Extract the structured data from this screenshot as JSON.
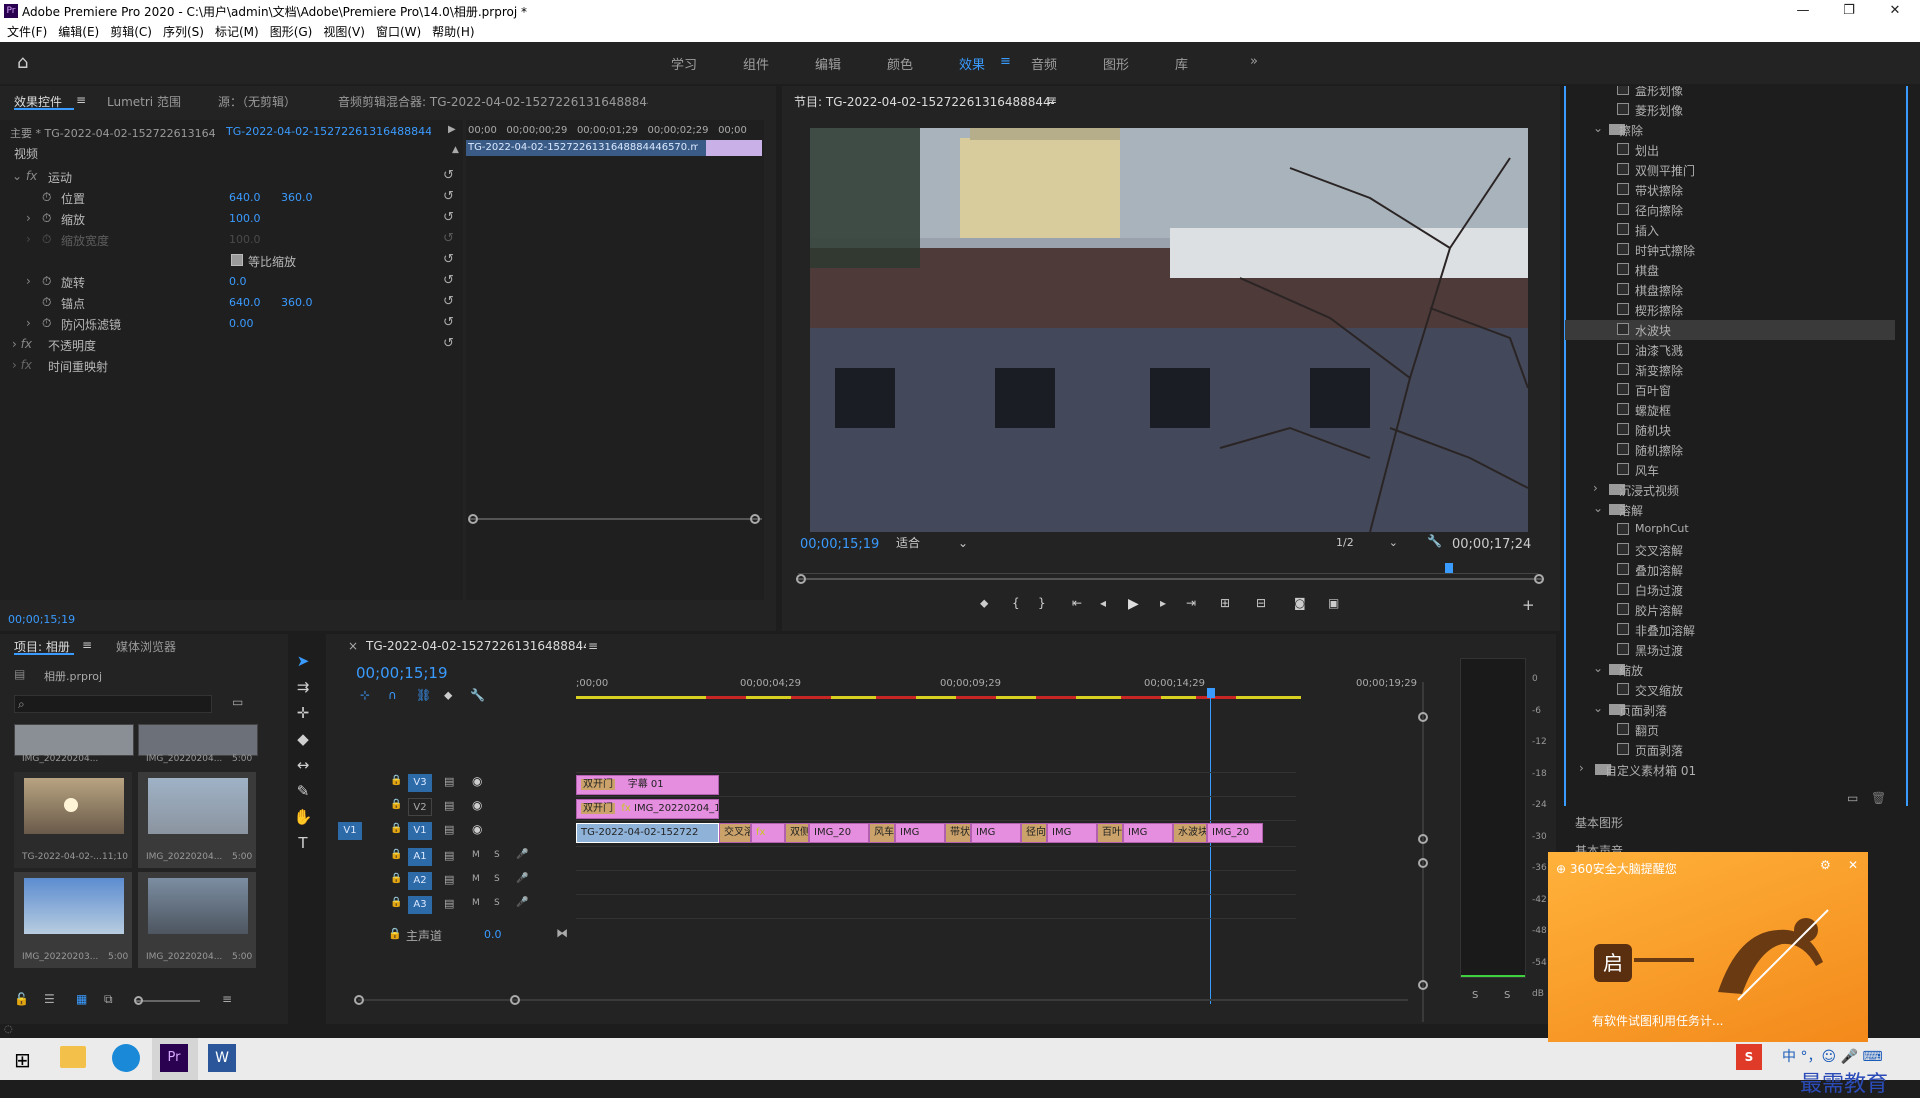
{
  "window": {
    "title": "Adobe Premiere Pro 2020 - C:\\用户\\admin\\文档\\Adobe\\Premiere Pro\\14.0\\相册.prproj *",
    "app_icon": "Pr"
  },
  "menu": [
    "文件(F)",
    "编辑(E)",
    "剪辑(C)",
    "序列(S)",
    "标记(M)",
    "图形(G)",
    "视图(V)",
    "窗口(W)",
    "帮助(H)"
  ],
  "workspaces": {
    "items": [
      "学习",
      "组件",
      "编辑",
      "颜色",
      "效果",
      "音频",
      "图形",
      "库"
    ],
    "active": "效果",
    "more": "»"
  },
  "effect_controls": {
    "tabs": [
      "效果控件",
      "Lumetri 范围",
      "源：（无剪辑）",
      "音频剪辑混合器: TG-2022-04-02-152722613164888444657​0"
    ],
    "master": "主要 * TG-2022-04-02-152722613164...",
    "clip": "TG-2022-04-02-15272261316488844...",
    "ruler": [
      "00;00",
      "00;00;00;29",
      "00;00;01;29",
      "00;00;02;29",
      "00;00"
    ],
    "clip_bar": "TG-2022-04-02-15272261316488844​46570.mp4",
    "video_label": "视频",
    "rows": [
      {
        "label": "运动"
      },
      {
        "label": "位置",
        "v1": "640.0",
        "v2": "360.0"
      },
      {
        "label": "缩放",
        "v1": "100.0"
      },
      {
        "label": "缩放宽度",
        "v1": "100.0"
      },
      {
        "label": "等比缩放"
      },
      {
        "label": "旋转",
        "v1": "0.0"
      },
      {
        "label": "锚点",
        "v1": "640.0",
        "v2": "360.0"
      },
      {
        "label": "防闪烁滤镜",
        "v1": "0.00"
      },
      {
        "label": "不透明度"
      },
      {
        "label": "时间重映射"
      }
    ],
    "timecode": "00;00;15;19"
  },
  "program": {
    "title": "节目: TG-2022-04-02-152722613164888444657​0",
    "timecode": "00;00;15;19",
    "fit": "适合",
    "resolution": "1/2",
    "duration": "00;00;17;24"
  },
  "effects_tree": [
    {
      "label": "盒形划像",
      "indent": 2
    },
    {
      "label": "菱形划像",
      "indent": 2
    },
    {
      "label": "擦除",
      "indent": 1,
      "folder": true
    },
    {
      "label": "划出",
      "indent": 2
    },
    {
      "label": "双侧平推门",
      "indent": 2
    },
    {
      "label": "带状擦除",
      "indent": 2
    },
    {
      "label": "径向擦除",
      "indent": 2
    },
    {
      "label": "插入",
      "indent": 2
    },
    {
      "label": "时钟式擦除",
      "indent": 2
    },
    {
      "label": "棋盘",
      "indent": 2
    },
    {
      "label": "棋盘擦除",
      "indent": 2
    },
    {
      "label": "楔形擦除",
      "indent": 2
    },
    {
      "label": "水波块",
      "indent": 2,
      "selected": true
    },
    {
      "label": "油漆飞溅",
      "indent": 2
    },
    {
      "label": "渐变擦除",
      "indent": 2
    },
    {
      "label": "百叶窗",
      "indent": 2
    },
    {
      "label": "螺旋框",
      "indent": 2
    },
    {
      "label": "随机块",
      "indent": 2
    },
    {
      "label": "随机擦除",
      "indent": 2
    },
    {
      "label": "风车",
      "indent": 2
    },
    {
      "label": "沉浸式视频",
      "indent": 1,
      "folder": true,
      "collapsed": true
    },
    {
      "label": "溶解",
      "indent": 1,
      "folder": true
    },
    {
      "label": "MorphCut",
      "indent": 2
    },
    {
      "label": "交叉溶解",
      "indent": 2
    },
    {
      "label": "叠加溶解",
      "indent": 2
    },
    {
      "label": "白场过渡",
      "indent": 2
    },
    {
      "label": "胶片溶解",
      "indent": 2
    },
    {
      "label": "非叠加溶解",
      "indent": 2
    },
    {
      "label": "黑场过渡",
      "indent": 2
    },
    {
      "label": "缩放",
      "indent": 1,
      "folder": true
    },
    {
      "label": "交叉缩放",
      "indent": 2
    },
    {
      "label": "页面剥落",
      "indent": 1,
      "folder": true
    },
    {
      "label": "翻页",
      "indent": 2
    },
    {
      "label": "页面剥落",
      "indent": 2
    },
    {
      "label": "自定义素材箱 01",
      "indent": 0,
      "folder": true,
      "collapsed": true
    }
  ],
  "side_panels": [
    "基本图形",
    "基本声音"
  ],
  "project": {
    "tabs": [
      "项目: 相册",
      "媒体浏览器"
    ],
    "file": "相册.prproj",
    "items": [
      {
        "name": "IMG_20220204...",
        "dur": ""
      },
      {
        "name": "IMG_20220204...",
        "dur": "5:00"
      },
      {
        "name": "TG-2022-04-02-...",
        "dur": "11;10"
      },
      {
        "name": "IMG_20220204...",
        "dur": "5:00"
      },
      {
        "name": "IMG_20220203...",
        "dur": "5:00"
      },
      {
        "name": "IMG_20220204...",
        "dur": "5:00"
      }
    ]
  },
  "timeline": {
    "name": "TG-2022-04-02-152722613164888444657​0",
    "timecode": "00;00;15;19",
    "ruler": [
      ";00;00",
      "00;00;04;29",
      "00;00;09;29",
      "00;00;14;29",
      "00;00;19;29"
    ],
    "tracks": [
      "V3",
      "V2",
      "V1",
      "A1",
      "A2",
      "A3"
    ],
    "master_label": "主声道",
    "master_val": "0.0",
    "v3_clips": [
      {
        "t": "双开门"
      },
      {
        "t": "字幕 01"
      }
    ],
    "v2_clips": [
      {
        "t": "双开门"
      },
      {
        "t": "IMG_20220204_17"
      }
    ],
    "v1_clips": [
      {
        "t": "TG-2022-04-02-152722"
      },
      {
        "t": "交叉溶"
      },
      {
        "t": ""
      },
      {
        "t": "双侧"
      },
      {
        "t": "IMG_20"
      },
      {
        "t": "风车"
      },
      {
        "t": "IMG"
      },
      {
        "t": "带状"
      },
      {
        "t": "IMG"
      },
      {
        "t": "径向"
      },
      {
        "t": "IMG"
      },
      {
        "t": "百叶"
      },
      {
        "t": "IMG"
      },
      {
        "t": "水波块"
      },
      {
        "t": "IMG_20"
      }
    ],
    "meter": [
      "0",
      "-6",
      "-12",
      "-18",
      "-24",
      "-30",
      "-36",
      "-42",
      "-48",
      "-54",
      "dB"
    ],
    "meter_solo": [
      "S",
      "S"
    ]
  },
  "popup": {
    "title": "360安全大脑提醒您",
    "body": "有软件试图利用任务计...",
    "btn": "启"
  },
  "taskbar": {
    "ime": "中 °，☺ 🎤 ⌨",
    "watermark": "最需教育"
  }
}
